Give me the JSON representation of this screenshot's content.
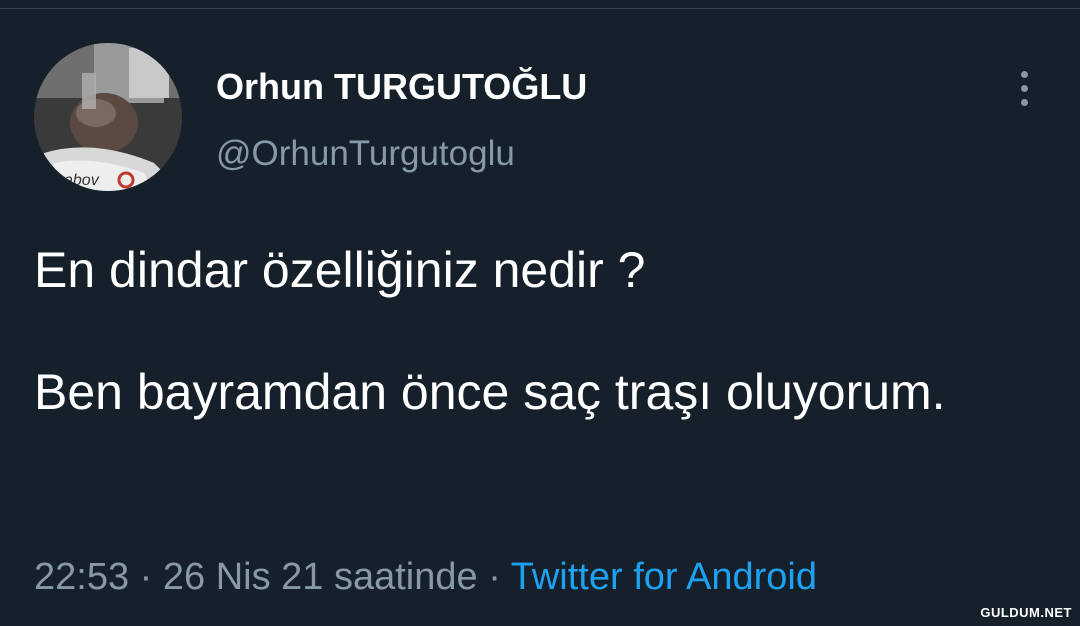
{
  "tweet": {
    "author": {
      "display_name": "Orhun TURGUTOĞLU",
      "handle": "@OrhunTurgutoglu",
      "avatar_icon": "user-avatar-photo"
    },
    "more_icon": "more-vertical-icon",
    "paragraphs": [
      "En dindar özelliğiniz nedir ?",
      "Ben bayramdan önce saç traşı oluyorum."
    ],
    "meta": {
      "time": "22:53",
      "separator": " · ",
      "date_text": "26 Nis 21 saatinde",
      "source": "Twitter for Android"
    }
  },
  "watermark": "GULDUM.NET",
  "colors": {
    "background": "#15202b",
    "text": "#ffffff",
    "secondary_text": "#8899a6",
    "link": "#1da1f2"
  }
}
